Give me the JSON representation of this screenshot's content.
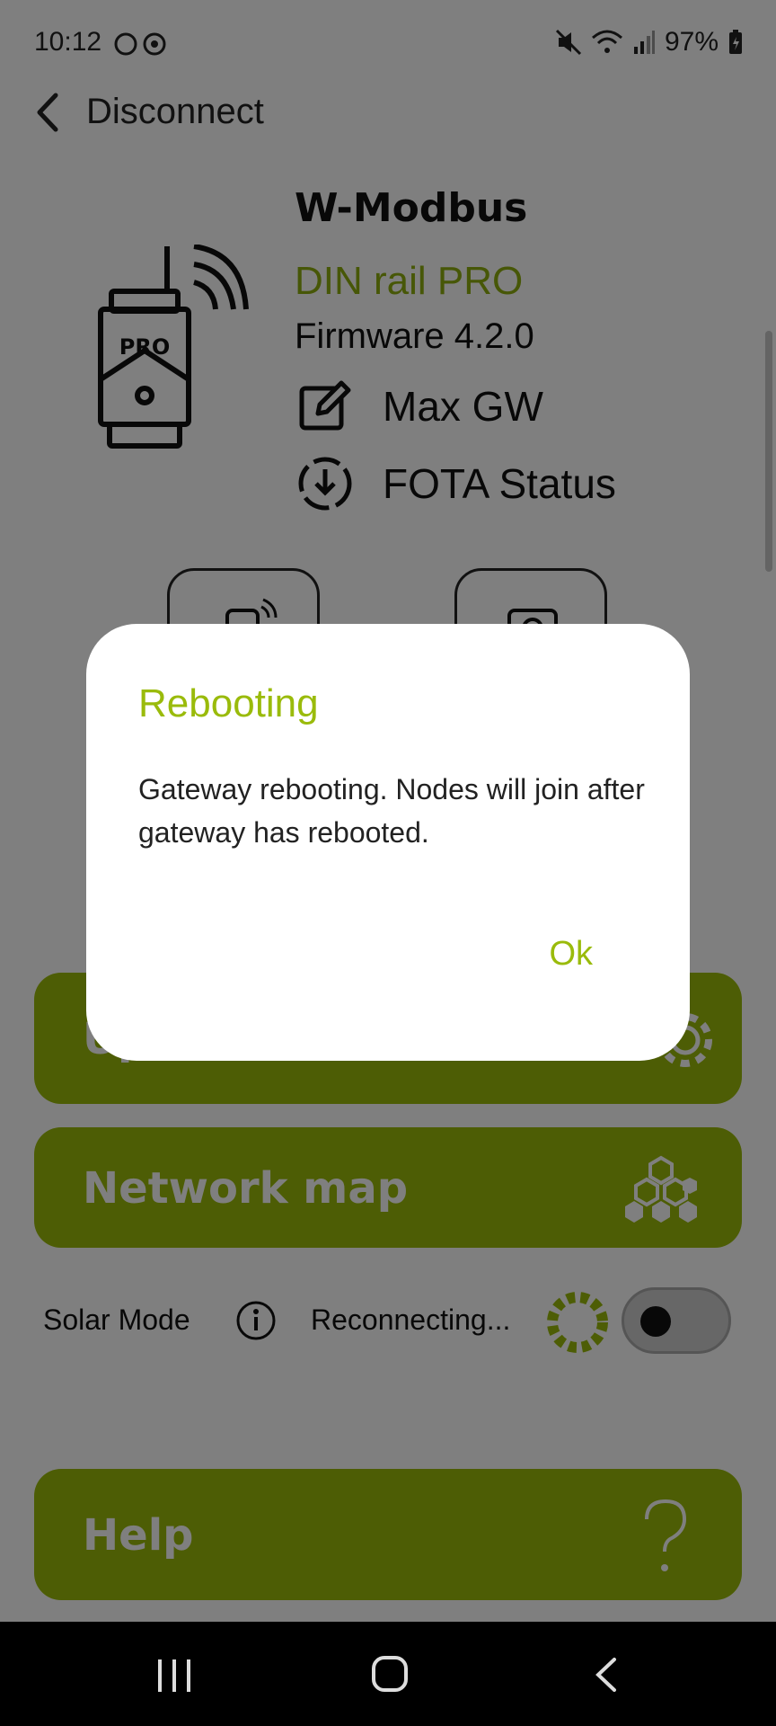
{
  "status_bar": {
    "time": "10:12",
    "battery": "97%"
  },
  "header": {
    "back_label": "Disconnect"
  },
  "device": {
    "brand": "W-Modbus",
    "model": "DIN rail PRO",
    "firmware": "Firmware 4.2.0",
    "name": "Max GW",
    "fota": "FOTA Status",
    "badge": "PRO"
  },
  "buttons": {
    "upper_partial": "Up",
    "network_map": "Network map",
    "help": "Help"
  },
  "solar": {
    "label": "Solar Mode",
    "status": "Reconnecting..."
  },
  "dialog": {
    "title": "Rebooting",
    "message": "Gateway rebooting. Nodes will join after gateway has rebooted.",
    "ok": "Ok"
  },
  "colors": {
    "accent": "#9abb0b",
    "scrim": "rgba(0,0,0,0.5)"
  }
}
